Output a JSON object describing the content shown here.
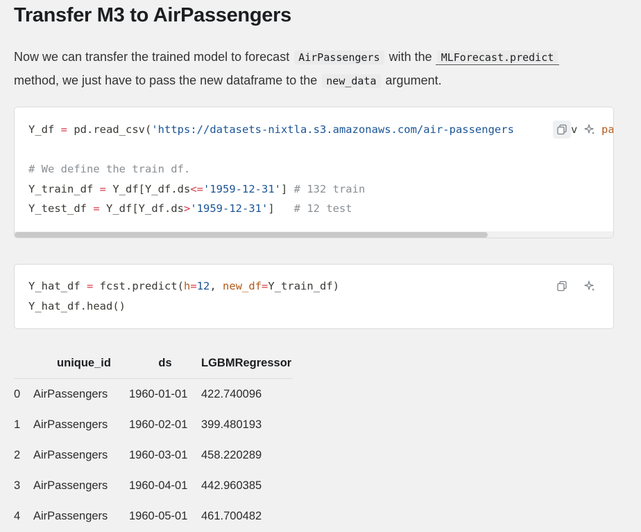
{
  "heading": "Transfer M3 to AirPassengers",
  "paragraph": {
    "part1": "Now we can transfer the trained model to forecast",
    "code1": "AirPassengers",
    "part2": "with the",
    "link_code": "MLForecast.predict",
    "part3": "method, we just have to pass the new dataframe to the",
    "code2": "new_data",
    "part4": "argument."
  },
  "code_block_1": {
    "line1": {
      "a": "Y_df ",
      "op": "=",
      "b": " pd.read_csv(",
      "str": "'https://datasets-nixtla.s3.amazonaws.com/air-passengers"
    },
    "overflow_char": "v",
    "overflow_tail": "pa",
    "line3": "# We define the train df.",
    "line4": {
      "a": "Y_train_df ",
      "op": "=",
      "b": " Y_df[Y_df.ds",
      "op2": "<=",
      "str": "'1959-12-31'",
      "c": "] ",
      "cm": "# 132 train"
    },
    "line5": {
      "a": "Y_test_df ",
      "op": "=",
      "b": " Y_df[Y_df.ds",
      "op2": ">",
      "str": "'1959-12-31'",
      "c": "]   ",
      "cm": "# 12 test"
    },
    "scroll_fraction": 0.79
  },
  "code_block_2": {
    "line1": {
      "a": "Y_hat_df ",
      "op": "=",
      "b": " fcst.predict(",
      "kw1": "h",
      "op2": "=",
      "num": "12",
      "c": ", ",
      "kw2": "new_df",
      "op3": "=",
      "d": "Y_train_df)"
    },
    "line2": "Y_hat_df.head()"
  },
  "table": {
    "columns": [
      "",
      "unique_id",
      "ds",
      "LGBMRegressor"
    ],
    "rows": [
      [
        "0",
        "AirPassengers",
        "1960-01-01",
        "422.740096"
      ],
      [
        "1",
        "AirPassengers",
        "1960-02-01",
        "399.480193"
      ],
      [
        "2",
        "AirPassengers",
        "1960-03-01",
        "458.220289"
      ],
      [
        "3",
        "AirPassengers",
        "1960-04-01",
        "442.960385"
      ],
      [
        "4",
        "AirPassengers",
        "1960-05-01",
        "461.700482"
      ]
    ]
  },
  "icons": {
    "copy": "copy-icon",
    "ai": "sparkle-icon"
  },
  "colors": {
    "background": "#f1f1f1",
    "code_bg": "#ffffff",
    "keyword_arg": "#b3591a",
    "string": "#1a5496",
    "operator": "#d73a49",
    "comment": "#8a8f93"
  }
}
